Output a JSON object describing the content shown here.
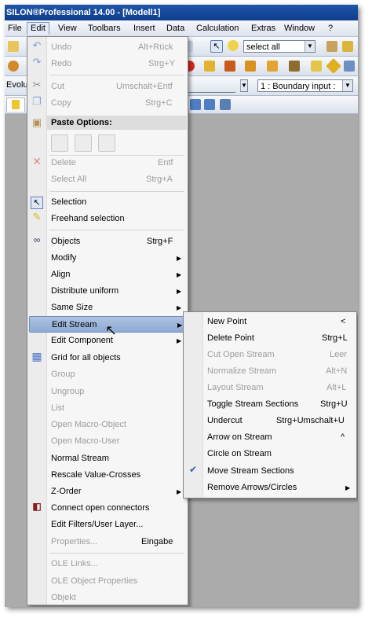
{
  "window": {
    "title": "SILON®Professional 14.00 - [Modell1]"
  },
  "menubar": [
    {
      "label": "File"
    },
    {
      "label": "Edit"
    },
    {
      "label": "View"
    },
    {
      "label": "Toolbars"
    },
    {
      "label": "Insert"
    },
    {
      "label": "Data"
    },
    {
      "label": "Calculation"
    },
    {
      "label": "Extras"
    },
    {
      "label": "Window"
    },
    {
      "label": "?"
    }
  ],
  "toolbar": {
    "select_combo": "select all",
    "boundary_combo": "1 : Boundary input :",
    "evolu_label": "Evolu"
  },
  "edit_menu": {
    "undo": {
      "label": "Undo",
      "shortcut": "Alt+Rück"
    },
    "redo": {
      "label": "Redo",
      "shortcut": "Strg+Y"
    },
    "cut": {
      "label": "Cut",
      "shortcut": "Umschalt+Entf"
    },
    "copy": {
      "label": "Copy",
      "shortcut": "Strg+C"
    },
    "paste_options": "Paste Options:",
    "delete": {
      "label": "Delete",
      "shortcut": "Entf"
    },
    "select_all": {
      "label": "Select All",
      "shortcut": "Strg+A"
    },
    "selection": "Selection",
    "freehand": "Freehand selection",
    "objects": {
      "label": "Objects",
      "shortcut": "Strg+F"
    },
    "modify": "Modify",
    "align": "Align",
    "distribute": "Distribute uniform",
    "same_size": "Same Size",
    "edit_stream": "Edit Stream",
    "edit_component": "Edit Component",
    "grid": "Grid for all objects",
    "group": "Group",
    "ungroup": "Ungroup",
    "list": "List",
    "open_macro_object": "Open Macro-Object",
    "open_macro_user": "Open Macro-User",
    "normal_stream": "Normal Stream",
    "rescale": "Rescale Value-Crosses",
    "z_order": "Z-Order",
    "connect": "Connect open connectors",
    "filters": "Edit Filters/User Layer...",
    "properties": {
      "label": "Properties...",
      "shortcut": "Eingabe"
    },
    "ole_links": "OLE Links...",
    "ole_props": "OLE Object Properties",
    "objekt": "Objekt"
  },
  "stream_submenu": {
    "new_point": {
      "label": "New Point",
      "shortcut": "<"
    },
    "delete_point": {
      "label": "Delete Point",
      "shortcut": "Strg+L"
    },
    "cut_open": {
      "label": "Cut Open Stream",
      "shortcut": "Leer"
    },
    "normalize": {
      "label": "Normalize Stream",
      "shortcut": "Alt+N"
    },
    "layout": {
      "label": "Layout Stream",
      "shortcut": "Alt+L"
    },
    "toggle": {
      "label": "Toggle Stream Sections",
      "shortcut": "Strg+U"
    },
    "undercut": {
      "label": "Undercut",
      "shortcut": "Strg+Umschalt+U"
    },
    "arrow": {
      "label": "Arrow on Stream",
      "shortcut": "^"
    },
    "circle": {
      "label": "Circle on Stream"
    },
    "move": {
      "label": "Move Stream Sections"
    },
    "remove": {
      "label": "Remove Arrows/Circles"
    }
  },
  "icons": {
    "submenu_arrow": "▶",
    "check": "✔",
    "binoculars": "binoculars-icon",
    "arrow_cursor": "arrow-cursor-icon"
  },
  "colors": {
    "title_bar": "#1f55a8",
    "highlight": "#9fb8de",
    "menu_bg": "#f6f6f6",
    "workspace": "#ababab"
  }
}
